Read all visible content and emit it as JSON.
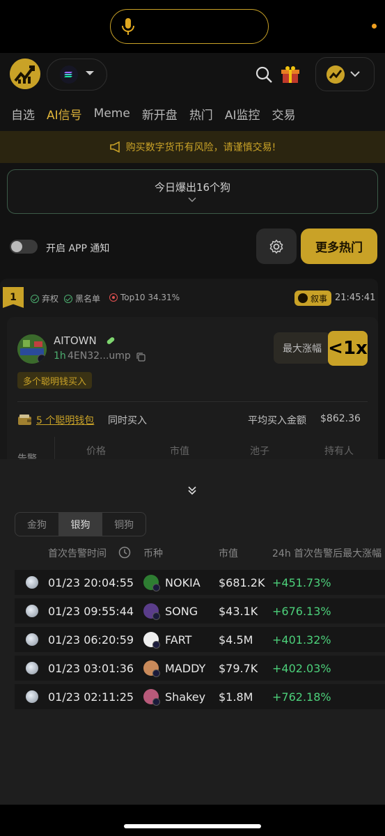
{
  "header": {
    "chain_icon": "solana-icon",
    "gift_icon": "gift-box-icon"
  },
  "nav": [
    "自选",
    "AI信号",
    "Meme",
    "新开盘",
    "热门",
    "AI监控",
    "交易"
  ],
  "nav_active_index": 1,
  "warning": "购买数字货币有风险，请谨慎交易!",
  "burst": {
    "text": "今日爆出16个狗"
  },
  "notify": {
    "label": "开启 APP 通知",
    "enabled": false
  },
  "more_hot": "更多热门",
  "card": {
    "rank": "1",
    "tags": [
      "弃权",
      "黑名单",
      "Top10 34.31%"
    ],
    "story": "叙事",
    "time": "21:45:41",
    "token": {
      "name": "AITOWN",
      "age": "1h",
      "address": "4EN32...ump"
    },
    "max_label": "最大涨幅",
    "max_value": "<1x",
    "smart_badge": "多个聪明钱买入",
    "wallets_link": "5 个聪明钱包",
    "wallets_rest": "同时买入",
    "avg_label": "平均买入金额",
    "avg_value": "$862.36",
    "alert_col": "告警",
    "columns": [
      "价格",
      "市值",
      "池子",
      "持有人"
    ]
  },
  "sheet": {
    "tabs": [
      "金狗",
      "银狗",
      "铜狗"
    ],
    "active_tab": 1,
    "headers": {
      "time": "首次告警时间",
      "coin": "币种",
      "mcap": "市值",
      "change": "24h 首次告警后最大涨幅"
    },
    "rows": [
      {
        "time": "01/23 20:04:55",
        "coin": "NOKIA",
        "mcap": "$681.2K",
        "change": "+451.73%",
        "avatar_color": "#2e7d32"
      },
      {
        "time": "01/23 09:55:44",
        "coin": "SONG",
        "mcap": "$43.1K",
        "change": "+676.13%",
        "avatar_color": "#5a3d8a"
      },
      {
        "time": "01/23 06:20:59",
        "coin": "FART",
        "mcap": "$4.5M",
        "change": "+401.32%",
        "avatar_color": "#eeeeee"
      },
      {
        "time": "01/23 03:01:36",
        "coin": "MADDY",
        "mcap": "$79.7K",
        "change": "+402.03%",
        "avatar_color": "#c98a5a"
      },
      {
        "time": "01/23 02:11:25",
        "coin": "Shakey",
        "mcap": "$1.8M",
        "change": "+762.18%",
        "avatar_color": "#b85a7a"
      }
    ]
  },
  "colors": {
    "accent": "#c9a227",
    "positive": "#4cd07a"
  }
}
